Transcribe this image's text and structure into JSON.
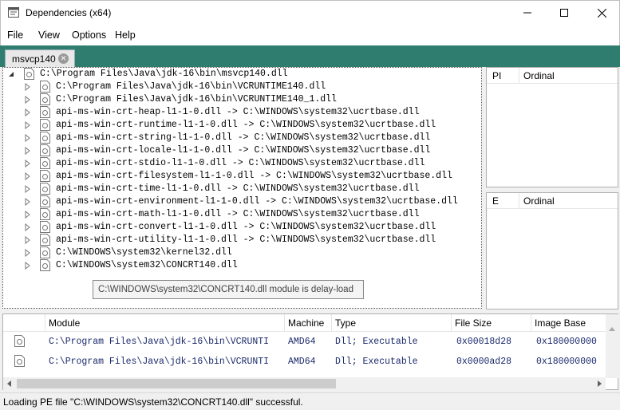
{
  "window": {
    "title": "Dependencies (x64)",
    "min_glyph": "—",
    "max_glyph": "☐",
    "close_glyph": "✕"
  },
  "menu": {
    "file": "File",
    "view": "View",
    "options": "Options",
    "help": "Help"
  },
  "tab": {
    "label": "msvcp140",
    "close_glyph": "✕",
    "strip_color": "#2e7d6e"
  },
  "tree": {
    "root": "C:\\Program Files\\Java\\jdk-16\\bin\\msvcp140.dll",
    "children": [
      "C:\\Program Files\\Java\\jdk-16\\bin\\VCRUNTIME140.dll",
      "C:\\Program Files\\Java\\jdk-16\\bin\\VCRUNTIME140_1.dll",
      "api-ms-win-crt-heap-l1-1-0.dll -> C:\\WINDOWS\\system32\\ucrtbase.dll",
      "api-ms-win-crt-runtime-l1-1-0.dll -> C:\\WINDOWS\\system32\\ucrtbase.dll",
      "api-ms-win-crt-string-l1-1-0.dll -> C:\\WINDOWS\\system32\\ucrtbase.dll",
      "api-ms-win-crt-locale-l1-1-0.dll -> C:\\WINDOWS\\system32\\ucrtbase.dll",
      "api-ms-win-crt-stdio-l1-1-0.dll -> C:\\WINDOWS\\system32\\ucrtbase.dll",
      "api-ms-win-crt-filesystem-l1-1-0.dll -> C:\\WINDOWS\\system32\\ucrtbase.dll",
      "api-ms-win-crt-time-l1-1-0.dll -> C:\\WINDOWS\\system32\\ucrtbase.dll",
      "api-ms-win-crt-environment-l1-1-0.dll -> C:\\WINDOWS\\system32\\ucrtbase.dll",
      "api-ms-win-crt-math-l1-1-0.dll -> C:\\WINDOWS\\system32\\ucrtbase.dll",
      "api-ms-win-crt-convert-l1-1-0.dll -> C:\\WINDOWS\\system32\\ucrtbase.dll",
      "api-ms-win-crt-utility-l1-1-0.dll -> C:\\WINDOWS\\system32\\ucrtbase.dll",
      "C:\\WINDOWS\\system32\\kernel32.dll",
      "C:\\WINDOWS\\system32\\CONCRT140.dll"
    ],
    "tooltip": "C:\\WINDOWS\\system32\\CONCRT140.dll module is delay-load"
  },
  "imports_panel": {
    "col_pi": "PI",
    "col_ordinal": "Ordinal"
  },
  "exports_panel": {
    "col_e": "E",
    "col_ordinal": "Ordinal"
  },
  "modules": {
    "headers": [
      "Module",
      "Machine",
      "Type",
      "File Size",
      "Image Base"
    ],
    "rows": [
      [
        "C:\\Program Files\\Java\\jdk-16\\bin\\VCRUNTI",
        "AMD64",
        "Dll; Executable",
        "0x00018d28",
        "0x180000000"
      ],
      [
        "C:\\Program Files\\Java\\jdk-16\\bin\\VCRUNTI",
        "AMD64",
        "Dll; Executable",
        "0x0000ad28",
        "0x180000000"
      ]
    ]
  },
  "status": "Loading PE file \"C:\\WINDOWS\\system32\\CONCRT140.dll\" successful."
}
